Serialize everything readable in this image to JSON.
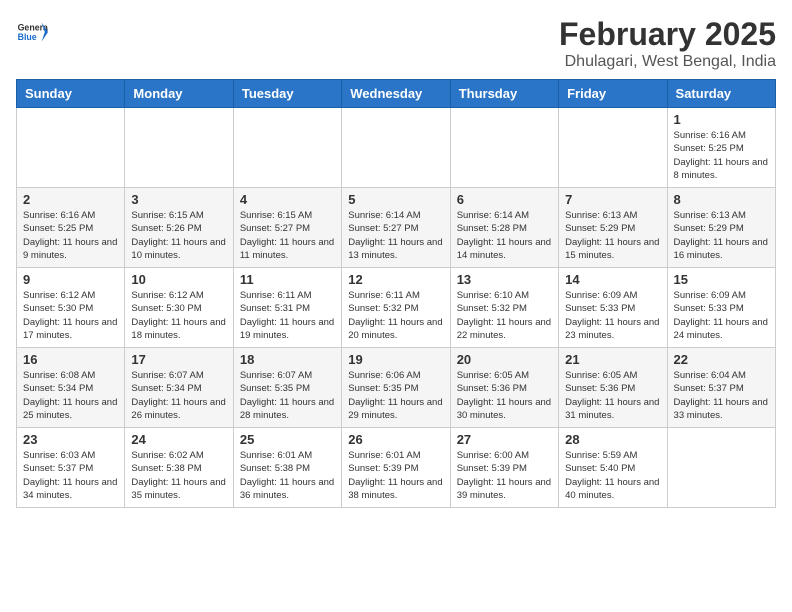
{
  "header": {
    "logo_general": "General",
    "logo_blue": "Blue",
    "month_year": "February 2025",
    "location": "Dhulagari, West Bengal, India"
  },
  "days_of_week": [
    "Sunday",
    "Monday",
    "Tuesday",
    "Wednesday",
    "Thursday",
    "Friday",
    "Saturday"
  ],
  "weeks": [
    [
      {
        "day": "",
        "info": ""
      },
      {
        "day": "",
        "info": ""
      },
      {
        "day": "",
        "info": ""
      },
      {
        "day": "",
        "info": ""
      },
      {
        "day": "",
        "info": ""
      },
      {
        "day": "",
        "info": ""
      },
      {
        "day": "1",
        "info": "Sunrise: 6:16 AM\nSunset: 5:25 PM\nDaylight: 11 hours and 8 minutes."
      }
    ],
    [
      {
        "day": "2",
        "info": "Sunrise: 6:16 AM\nSunset: 5:25 PM\nDaylight: 11 hours and 9 minutes."
      },
      {
        "day": "3",
        "info": "Sunrise: 6:15 AM\nSunset: 5:26 PM\nDaylight: 11 hours and 10 minutes."
      },
      {
        "day": "4",
        "info": "Sunrise: 6:15 AM\nSunset: 5:27 PM\nDaylight: 11 hours and 11 minutes."
      },
      {
        "day": "5",
        "info": "Sunrise: 6:14 AM\nSunset: 5:27 PM\nDaylight: 11 hours and 13 minutes."
      },
      {
        "day": "6",
        "info": "Sunrise: 6:14 AM\nSunset: 5:28 PM\nDaylight: 11 hours and 14 minutes."
      },
      {
        "day": "7",
        "info": "Sunrise: 6:13 AM\nSunset: 5:29 PM\nDaylight: 11 hours and 15 minutes."
      },
      {
        "day": "8",
        "info": "Sunrise: 6:13 AM\nSunset: 5:29 PM\nDaylight: 11 hours and 16 minutes."
      }
    ],
    [
      {
        "day": "9",
        "info": "Sunrise: 6:12 AM\nSunset: 5:30 PM\nDaylight: 11 hours and 17 minutes."
      },
      {
        "day": "10",
        "info": "Sunrise: 6:12 AM\nSunset: 5:30 PM\nDaylight: 11 hours and 18 minutes."
      },
      {
        "day": "11",
        "info": "Sunrise: 6:11 AM\nSunset: 5:31 PM\nDaylight: 11 hours and 19 minutes."
      },
      {
        "day": "12",
        "info": "Sunrise: 6:11 AM\nSunset: 5:32 PM\nDaylight: 11 hours and 20 minutes."
      },
      {
        "day": "13",
        "info": "Sunrise: 6:10 AM\nSunset: 5:32 PM\nDaylight: 11 hours and 22 minutes."
      },
      {
        "day": "14",
        "info": "Sunrise: 6:09 AM\nSunset: 5:33 PM\nDaylight: 11 hours and 23 minutes."
      },
      {
        "day": "15",
        "info": "Sunrise: 6:09 AM\nSunset: 5:33 PM\nDaylight: 11 hours and 24 minutes."
      }
    ],
    [
      {
        "day": "16",
        "info": "Sunrise: 6:08 AM\nSunset: 5:34 PM\nDaylight: 11 hours and 25 minutes."
      },
      {
        "day": "17",
        "info": "Sunrise: 6:07 AM\nSunset: 5:34 PM\nDaylight: 11 hours and 26 minutes."
      },
      {
        "day": "18",
        "info": "Sunrise: 6:07 AM\nSunset: 5:35 PM\nDaylight: 11 hours and 28 minutes."
      },
      {
        "day": "19",
        "info": "Sunrise: 6:06 AM\nSunset: 5:35 PM\nDaylight: 11 hours and 29 minutes."
      },
      {
        "day": "20",
        "info": "Sunrise: 6:05 AM\nSunset: 5:36 PM\nDaylight: 11 hours and 30 minutes."
      },
      {
        "day": "21",
        "info": "Sunrise: 6:05 AM\nSunset: 5:36 PM\nDaylight: 11 hours and 31 minutes."
      },
      {
        "day": "22",
        "info": "Sunrise: 6:04 AM\nSunset: 5:37 PM\nDaylight: 11 hours and 33 minutes."
      }
    ],
    [
      {
        "day": "23",
        "info": "Sunrise: 6:03 AM\nSunset: 5:37 PM\nDaylight: 11 hours and 34 minutes."
      },
      {
        "day": "24",
        "info": "Sunrise: 6:02 AM\nSunset: 5:38 PM\nDaylight: 11 hours and 35 minutes."
      },
      {
        "day": "25",
        "info": "Sunrise: 6:01 AM\nSunset: 5:38 PM\nDaylight: 11 hours and 36 minutes."
      },
      {
        "day": "26",
        "info": "Sunrise: 6:01 AM\nSunset: 5:39 PM\nDaylight: 11 hours and 38 minutes."
      },
      {
        "day": "27",
        "info": "Sunrise: 6:00 AM\nSunset: 5:39 PM\nDaylight: 11 hours and 39 minutes."
      },
      {
        "day": "28",
        "info": "Sunrise: 5:59 AM\nSunset: 5:40 PM\nDaylight: 11 hours and 40 minutes."
      },
      {
        "day": "",
        "info": ""
      }
    ]
  ]
}
